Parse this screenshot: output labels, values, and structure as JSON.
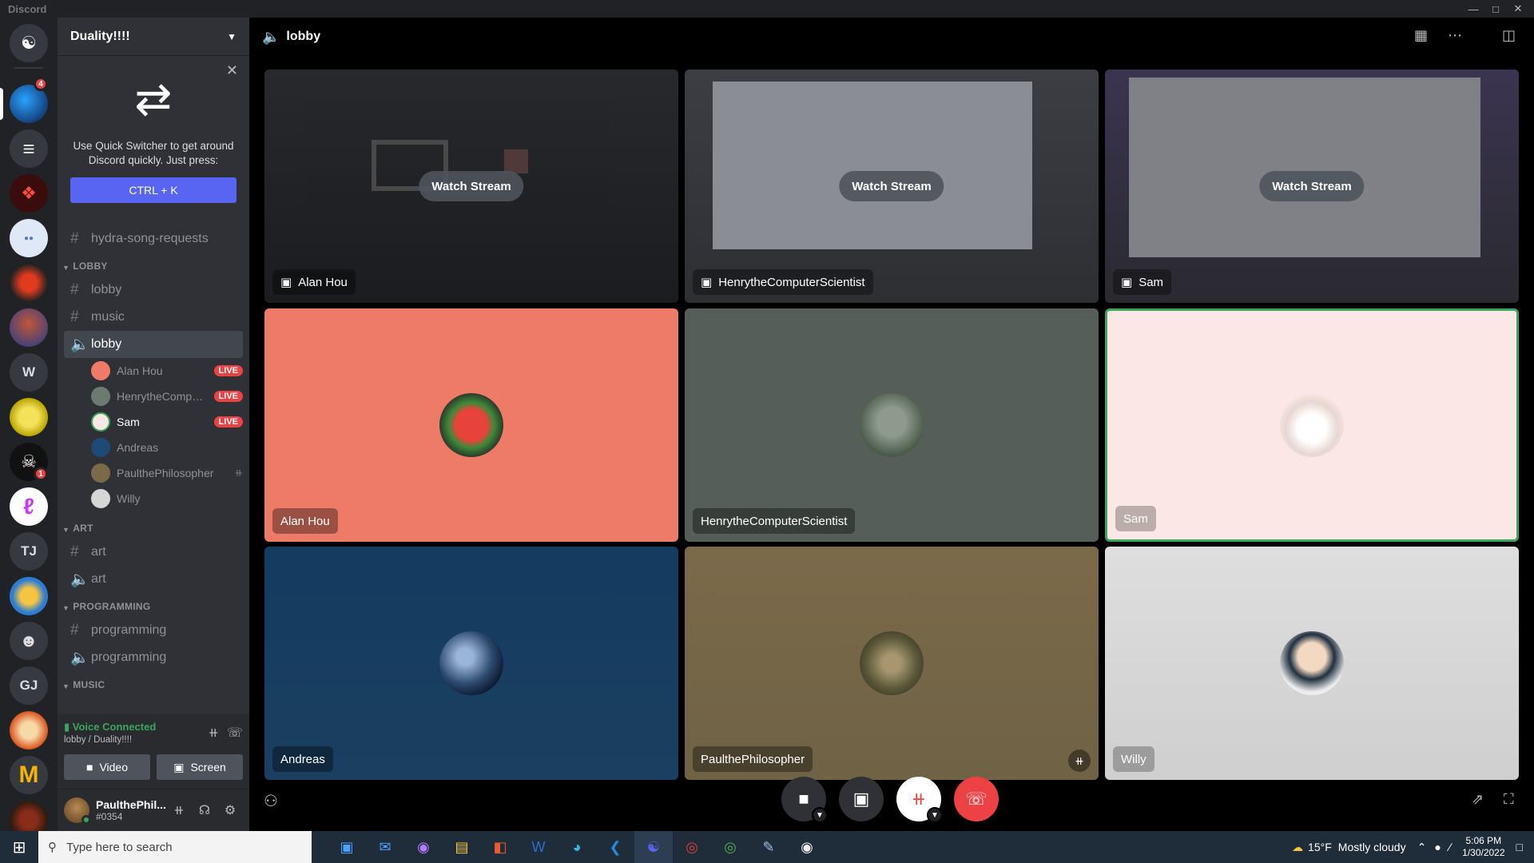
{
  "window": {
    "app_name": "Discord"
  },
  "servers": [
    {
      "id": "home",
      "label": ""
    },
    {
      "id": "s1",
      "label": ""
    },
    {
      "id": "s2",
      "label": ""
    },
    {
      "id": "s3",
      "label": ""
    },
    {
      "id": "s4",
      "label": ""
    },
    {
      "id": "s5",
      "label": ""
    },
    {
      "id": "s6",
      "label": ""
    },
    {
      "id": "w",
      "label": "W"
    },
    {
      "id": "s8",
      "label": ""
    },
    {
      "id": "s9",
      "label": "",
      "badge": "1"
    },
    {
      "id": "s10",
      "label": ""
    },
    {
      "id": "tj",
      "label": "TJ"
    },
    {
      "id": "s12",
      "label": ""
    },
    {
      "id": "s13",
      "label": ""
    },
    {
      "id": "gj",
      "label": "GJ"
    },
    {
      "id": "s15",
      "label": ""
    },
    {
      "id": "s16",
      "label": ""
    },
    {
      "id": "s17",
      "label": ""
    }
  ],
  "server_badge_top": "4",
  "guild": {
    "name": "Duality!!!!"
  },
  "quick_switcher": {
    "text": "Use Quick Switcher to get around Discord quickly. Just press:",
    "shortcut": "CTRL + K"
  },
  "channels": {
    "top": "hydra-song-requests",
    "cat_lobby": "LOBBY",
    "lobby_text": "lobby",
    "music": "music",
    "lobby_voice": "lobby",
    "voice_users": [
      {
        "name": "Alan Hou",
        "live": "LIVE"
      },
      {
        "name": "HenrytheComputerScientist",
        "live": "LIVE"
      },
      {
        "name": "Sam",
        "live": "LIVE"
      },
      {
        "name": "Andreas"
      },
      {
        "name": "PaulthePhilosopher",
        "muted": true
      },
      {
        "name": "Willy"
      }
    ],
    "cat_art": "ART",
    "art_text": "art",
    "art_voice": "art",
    "cat_programming": "PROGRAMMING",
    "programming_text": "programming",
    "programming_voice": "programming",
    "cat_music": "MUSIC"
  },
  "voice_panel": {
    "status": "Voice Connected",
    "location": "lobby / Duality!!!!",
    "video_label": "Video",
    "screen_label": "Screen"
  },
  "user": {
    "name": "PaulthePhil...",
    "tag": "#0354"
  },
  "stage": {
    "channel": "lobby",
    "watch_label": "Watch Stream",
    "streams": [
      {
        "name": "Alan Hou"
      },
      {
        "name": "HenrytheComputerScientist"
      },
      {
        "name": "Sam"
      }
    ],
    "tiles": [
      {
        "name": "Alan Hou",
        "bg": "#ee7b68"
      },
      {
        "name": "HenrytheComputerScientist",
        "bg": "#555e58"
      },
      {
        "name": "Sam",
        "bg": "#fbe7e5"
      },
      {
        "name": "Andreas",
        "bg": "#153d62"
      },
      {
        "name": "PaulthePhilosopher",
        "bg": "#7b6a4a"
      },
      {
        "name": "Willy",
        "bg": "#dddddd"
      }
    ]
  },
  "taskbar": {
    "search_placeholder": "Type here to search",
    "weather_temp": "15°F",
    "weather_text": "Mostly cloudy",
    "time": "5:06 PM",
    "date": "1/30/2022"
  },
  "colors": {
    "blurple": "#5865f2",
    "live_red": "#ed4245",
    "voice_green": "#3ba55d"
  }
}
